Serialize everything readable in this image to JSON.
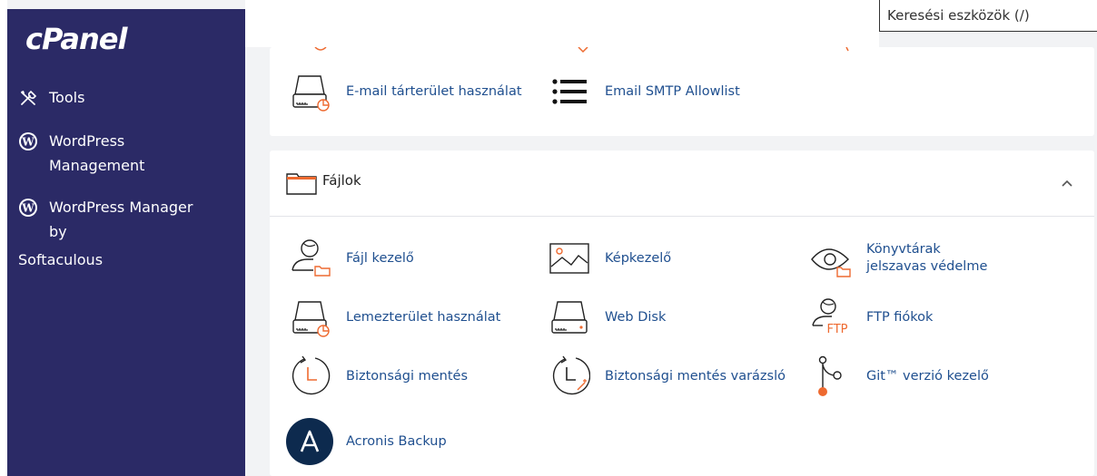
{
  "app": {
    "logo_text": "cPanel"
  },
  "search": {
    "placeholder": "Keresési eszközök (/)"
  },
  "sidebar": {
    "items": [
      {
        "label": "Tools",
        "icon": "tools-icon"
      },
      {
        "label": "WordPress Management",
        "icon": "wordpress-icon"
      },
      {
        "label": "WordPress Manager by",
        "icon": "wordpress-icon"
      }
    ],
    "softaculous_label": "Softaculous"
  },
  "email_section": {
    "tools": [
      {
        "label": "E-mail tárterület használat",
        "icon": "disk-usage-icon"
      },
      {
        "label": "Email SMTP Allowlist",
        "icon": "list-icon"
      }
    ]
  },
  "files_section": {
    "title": "Fájlok",
    "tools": [
      {
        "label": "Fájl kezelő",
        "icon": "file-manager-icon"
      },
      {
        "label": "Képkezelő",
        "icon": "image-icon"
      },
      {
        "label": "Könyvtárak jelszavas védelme",
        "icon": "privacy-icon"
      },
      {
        "label": "Lemezterület használat",
        "icon": "disk-usage-icon"
      },
      {
        "label": "Web Disk",
        "icon": "web-disk-icon"
      },
      {
        "label": "FTP fiókok",
        "icon": "ftp-icon"
      },
      {
        "label": "Biztonsági mentés",
        "icon": "backup-icon"
      },
      {
        "label": "Biztonsági mentés varázsló",
        "icon": "backup-wizard-icon"
      },
      {
        "label": "Git™ verzió kezelő",
        "icon": "git-icon"
      },
      {
        "label": "Acronis Backup",
        "icon": "acronis-icon"
      }
    ]
  },
  "colors": {
    "sidebar_bg": "#2b2a66",
    "accent_orange": "#ee6a30",
    "link_blue": "#1f4f8f",
    "page_bg": "#f2f3f5"
  }
}
